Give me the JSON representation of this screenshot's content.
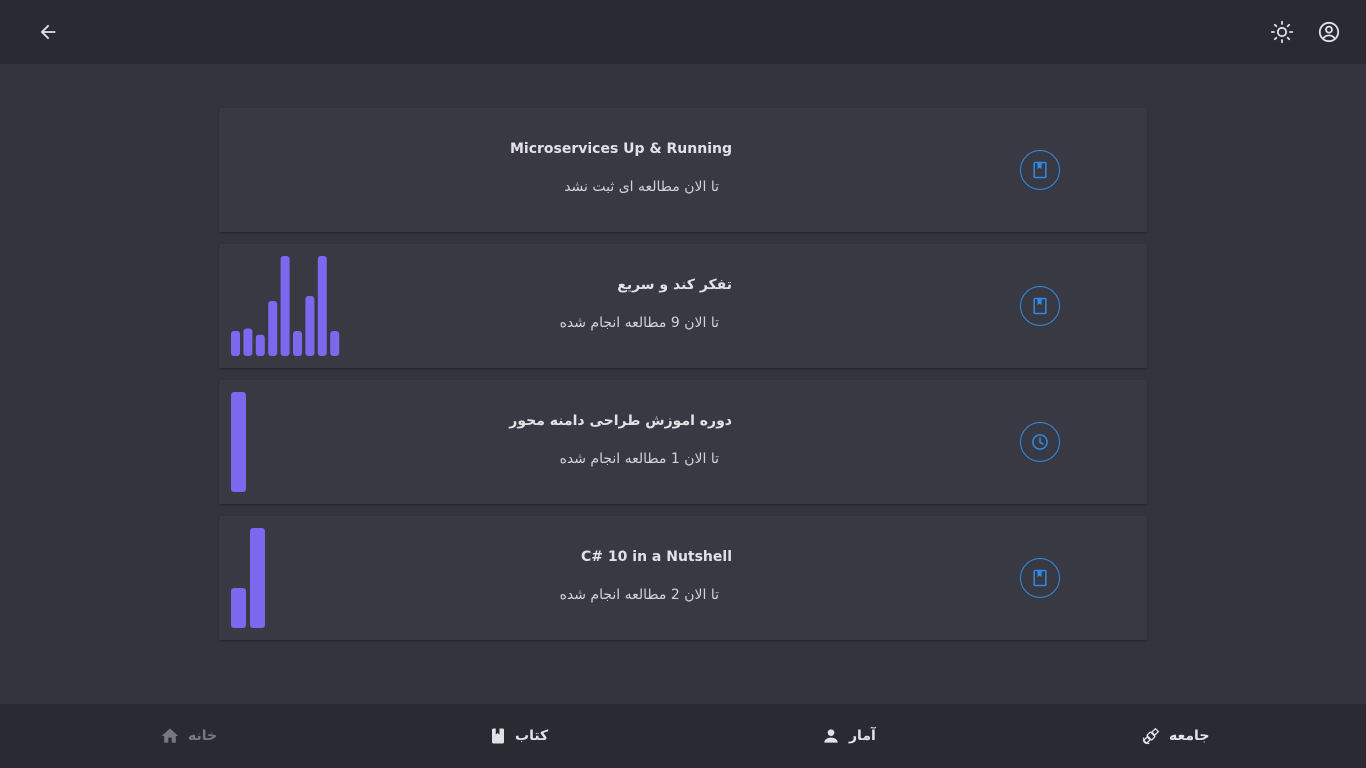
{
  "header": {
    "back_icon": "arrow-left-icon",
    "theme_icon": "sun-icon",
    "account_icon": "account-circle-icon"
  },
  "colors": {
    "accent": "#2f8be6",
    "bar": "#7b68ee",
    "surface": "#393943",
    "background": "#34343f",
    "bar_bg": "#2a2a33"
  },
  "books": [
    {
      "title": "Microservices Up & Running",
      "subtitle": "تا الان مطالعه ای ثبت نشد",
      "icon": "book-bookmark-icon",
      "chart_data": {
        "type": "bar",
        "values": []
      }
    },
    {
      "title": "تفکر کند و سریع",
      "subtitle": "تا الان 9 مطالعه انجام شده",
      "icon": "book-bookmark-icon",
      "chart_data": {
        "type": "bar",
        "values": [
          1,
          1.1,
          0.85,
          2.2,
          4,
          1,
          2.4,
          4,
          1
        ]
      }
    },
    {
      "title": "دوره اموزش طراحی دامنه محور",
      "subtitle": "تا الان 1 مطالعه انجام شده",
      "icon": "clock-icon",
      "chart_data": {
        "type": "bar",
        "values": [
          1
        ]
      }
    },
    {
      "title": "C# 10 in a Nutshell",
      "subtitle": "تا الان 2 مطالعه انجام شده",
      "icon": "book-bookmark-icon",
      "chart_data": {
        "type": "bar",
        "values": [
          1,
          2.5
        ]
      }
    }
  ],
  "bottom_nav": {
    "home": {
      "label": "خانه",
      "icon": "home-icon"
    },
    "book": {
      "label": "کتاب",
      "icon": "book-icon"
    },
    "stats": {
      "label": "آمار",
      "icon": "person-icon"
    },
    "community": {
      "label": "جامعه",
      "icon": "satellite-icon"
    }
  }
}
